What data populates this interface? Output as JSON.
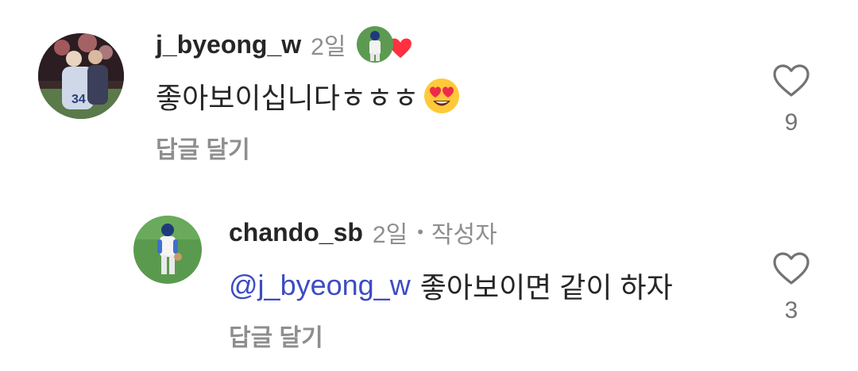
{
  "comments": [
    {
      "username": "j_byeong_w",
      "time": "2일",
      "text": "좋아보이십니다ㅎㅎㅎ",
      "reply_label": "답글 달기",
      "like_count": "9",
      "avatar_icon": "avatar-fireworks-photo",
      "liked_by_author": true
    },
    {
      "username": "chando_sb",
      "time": "2일",
      "separator": "•",
      "author_badge": "작성자",
      "mention": "@j_byeong_w",
      "text": "좋아보이면 같이 하자",
      "reply_label": "답글 달기",
      "like_count": "3",
      "avatar_icon": "avatar-baseball-player-photo"
    }
  ],
  "colors": {
    "mention": "#3d4cc4",
    "muted": "#8e8e8e",
    "heart": "#ff3040"
  }
}
